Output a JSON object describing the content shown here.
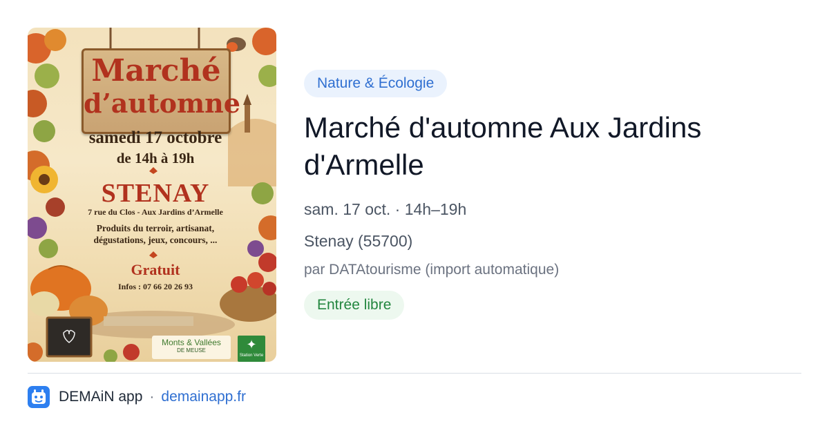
{
  "poster": {
    "title_line1": "Marché",
    "title_line2": "d’automne",
    "date": "samedi 17 octobre",
    "time": "de 14h à 19h",
    "town": "STENAY",
    "address": "7 rue du Clos - Aux Jardins d’Armelle",
    "products_line1": "Produits du terroir, artisanat,",
    "products_line2": "dégustations, jeux, concours, ...",
    "price": "Gratuit",
    "info": "Infos : 07 66 20 26 93",
    "logo_line1": "Monts & Vallées",
    "logo_line2": "DE MEUSE",
    "logo2_text": "Station Verte"
  },
  "event": {
    "category": "Nature & Écologie",
    "title": "Marché d'automne Aux Jardins d'Armelle",
    "datetime": "sam. 17 oct. · 14h–19h",
    "location": "Stenay (55700)",
    "source": "par DATAtourisme (import automatique)",
    "price": "Entrée libre"
  },
  "footer": {
    "app_name": "DEMAiN app",
    "separator": "·",
    "url": "demainapp.fr"
  },
  "colors": {
    "tag_bg": "#eaf2fd",
    "tag_text": "#2f6fd1",
    "price_bg": "#edf8ef",
    "price_text": "#23863f",
    "title_text": "#111827",
    "link": "#2f6fd1",
    "app_icon": "#2d7ff0"
  }
}
